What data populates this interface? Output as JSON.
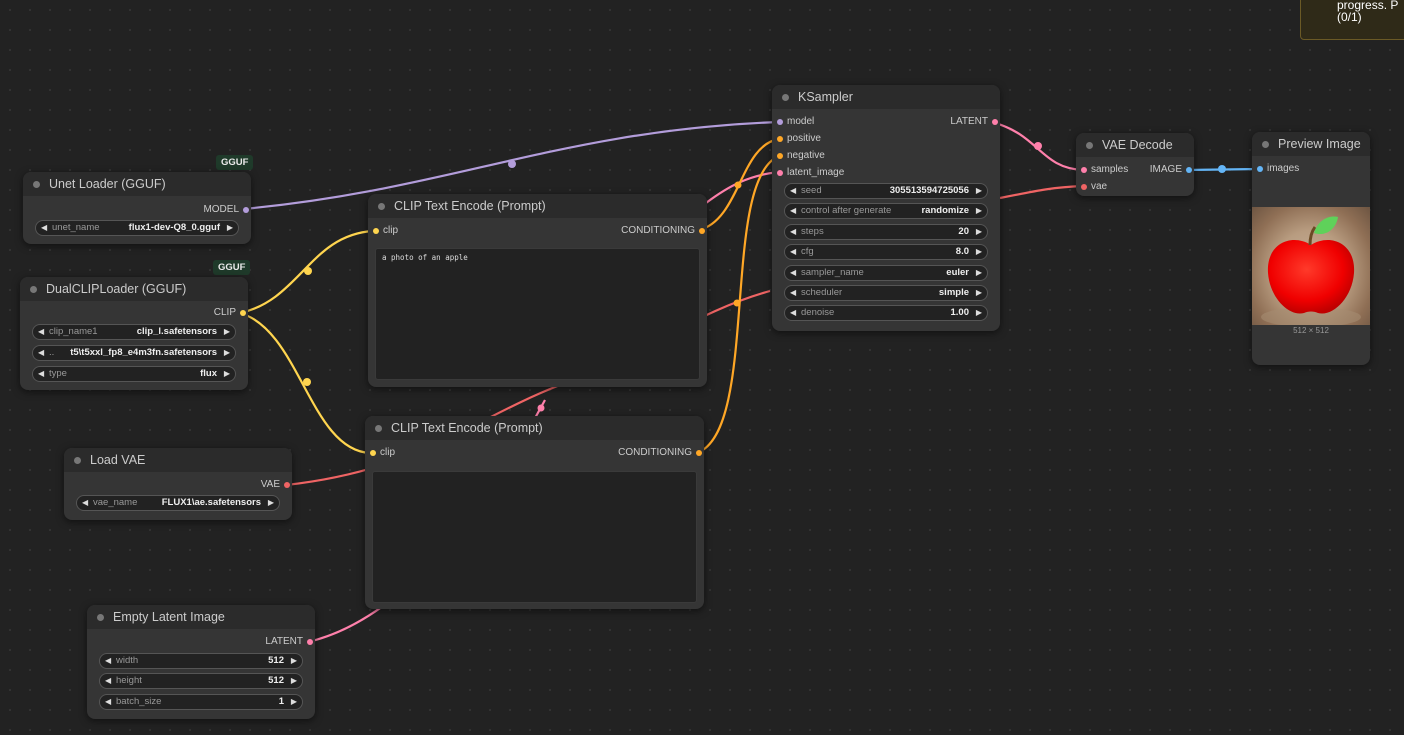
{
  "toast": {
    "line1": "progress. P",
    "line2": "(0/1)"
  },
  "badges": {
    "unet": "GGUF",
    "dualclip": "GGUF"
  },
  "colors": {
    "model": "#b39ddb",
    "clip": "#ffd54f",
    "conditioning": "#ffa726",
    "latent": "#ff80ab",
    "vae": "#ef6464",
    "image": "#64b5f6"
  },
  "unet_loader": {
    "title": "Unet Loader (GGUF)",
    "out_model": "MODEL",
    "w_unet_name": {
      "label": "unet_name",
      "value": "flux1-dev-Q8_0.gguf"
    }
  },
  "dual_clip": {
    "title": "DualCLIPLoader (GGUF)",
    "out_clip": "CLIP",
    "w_clip_name1": {
      "label": "clip_name1",
      "value": "clip_l.safetensors"
    },
    "w_clip_name2": {
      "label": "..",
      "value": "t5\\t5xxl_fp8_e4m3fn.safetensors"
    },
    "w_type": {
      "label": "type",
      "value": "flux"
    }
  },
  "load_vae": {
    "title": "Load VAE",
    "out_vae": "VAE",
    "w_vae_name": {
      "label": "vae_name",
      "value": "FLUX1\\ae.safetensors"
    }
  },
  "empty_latent": {
    "title": "Empty Latent Image",
    "out_latent": "LATENT",
    "w_width": {
      "label": "width",
      "value": "512"
    },
    "w_height": {
      "label": "height",
      "value": "512"
    },
    "w_batch": {
      "label": "batch_size",
      "value": "1"
    }
  },
  "clip_pos": {
    "title": "CLIP Text Encode (Prompt)",
    "in_clip": "clip",
    "out_cond": "CONDITIONING",
    "text": "a photo of an apple"
  },
  "clip_neg": {
    "title": "CLIP Text Encode (Prompt)",
    "in_clip": "clip",
    "out_cond": "CONDITIONING",
    "text": ""
  },
  "ksampler": {
    "title": "KSampler",
    "in_model": "model",
    "in_positive": "positive",
    "in_negative": "negative",
    "in_latent": "latent_image",
    "out_latent": "LATENT",
    "w_seed": {
      "label": "seed",
      "value": "305513594725056"
    },
    "w_control": {
      "label": "control after generate",
      "value": "randomize"
    },
    "w_steps": {
      "label": "steps",
      "value": "20"
    },
    "w_cfg": {
      "label": "cfg",
      "value": "8.0"
    },
    "w_sampler": {
      "label": "sampler_name",
      "value": "euler"
    },
    "w_scheduler": {
      "label": "scheduler",
      "value": "simple"
    },
    "w_denoise": {
      "label": "denoise",
      "value": "1.00"
    }
  },
  "vae_decode": {
    "title": "VAE Decode",
    "in_samples": "samples",
    "in_vae": "vae",
    "out_image": "IMAGE"
  },
  "preview": {
    "title": "Preview Image",
    "in_images": "images",
    "size": "512 × 512"
  }
}
